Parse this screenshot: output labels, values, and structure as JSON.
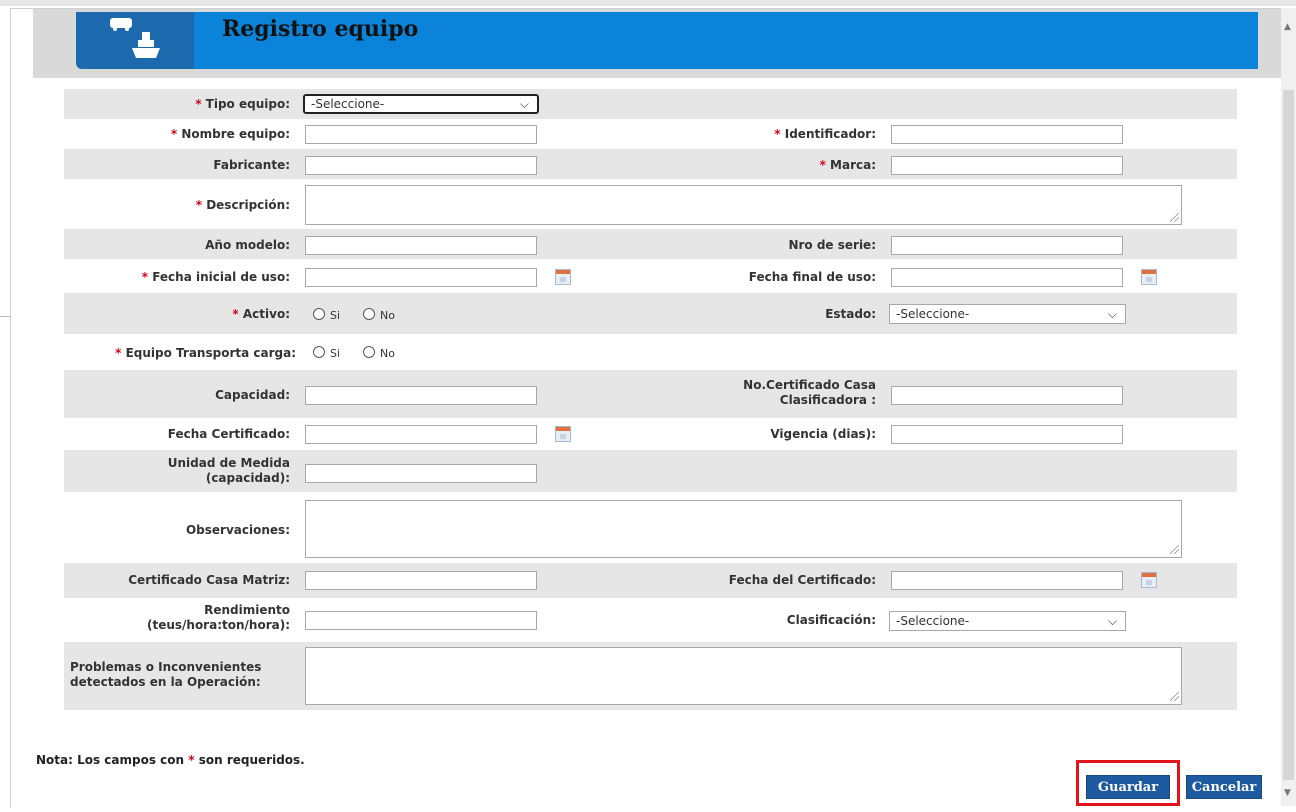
{
  "dialog": {
    "title": "Registro equipo"
  },
  "form": {
    "tipo_equipo": {
      "label": "Tipo equipo:",
      "value": "-Seleccione-"
    },
    "nombre_equipo": {
      "label": "Nombre equipo:",
      "value": ""
    },
    "identificador": {
      "label": "Identificador:",
      "value": ""
    },
    "fabricante": {
      "label": "Fabricante:",
      "value": ""
    },
    "marca": {
      "label": "Marca:",
      "value": ""
    },
    "descripcion": {
      "label": "Descripción:",
      "value": ""
    },
    "anio_modelo": {
      "label": "Año modelo:",
      "value": ""
    },
    "nro_serie": {
      "label": "Nro de serie:",
      "value": ""
    },
    "fecha_inicial": {
      "label": "Fecha inicial de uso:",
      "value": ""
    },
    "fecha_final": {
      "label": "Fecha final de uso:",
      "value": ""
    },
    "activo": {
      "label": "Activo:",
      "options": [
        "Si",
        "No"
      ]
    },
    "estado": {
      "label": "Estado:",
      "value": "-Seleccione-"
    },
    "transporta_carga": {
      "label": "Equipo Transporta carga:",
      "options": [
        "Si",
        "No"
      ]
    },
    "capacidad": {
      "label": "Capacidad:",
      "value": ""
    },
    "no_certificado": {
      "label_line1": "No.Certificado Casa",
      "label_line2": "Clasificadora :",
      "value": ""
    },
    "fecha_certificado": {
      "label": "Fecha Certificado:",
      "value": ""
    },
    "vigencia": {
      "label": "Vigencia (dias):",
      "value": ""
    },
    "unidad_medida": {
      "label_line1": "Unidad de Medida",
      "label_line2": "(capacidad):",
      "value": ""
    },
    "observaciones": {
      "label": "Observaciones:",
      "value": ""
    },
    "certificado_casa_matriz": {
      "label": "Certificado Casa Matriz:",
      "value": ""
    },
    "fecha_del_certificado": {
      "label": "Fecha del Certificado:",
      "value": ""
    },
    "rendimiento": {
      "label_line1": "Rendimiento",
      "label_line2": "(teus/hora:ton/hora):",
      "value": ""
    },
    "clasificacion": {
      "label": "Clasificación:",
      "value": "-Seleccione-"
    },
    "problemas": {
      "label_line1": "Problemas o Inconvenientes",
      "label_line2": "detectados en la Operación:",
      "value": ""
    }
  },
  "required_mark": "*",
  "note": {
    "prefix": "Nota: Los campos con ",
    "mark": "*",
    "suffix": " son requeridos."
  },
  "buttons": {
    "save": "Guardar",
    "cancel": "Cancelar"
  },
  "colors": {
    "header_blue": "#0b83d8",
    "button_blue": "#1e5aa0",
    "required_red": "#d0021b",
    "highlight_red": "#e0141c"
  }
}
